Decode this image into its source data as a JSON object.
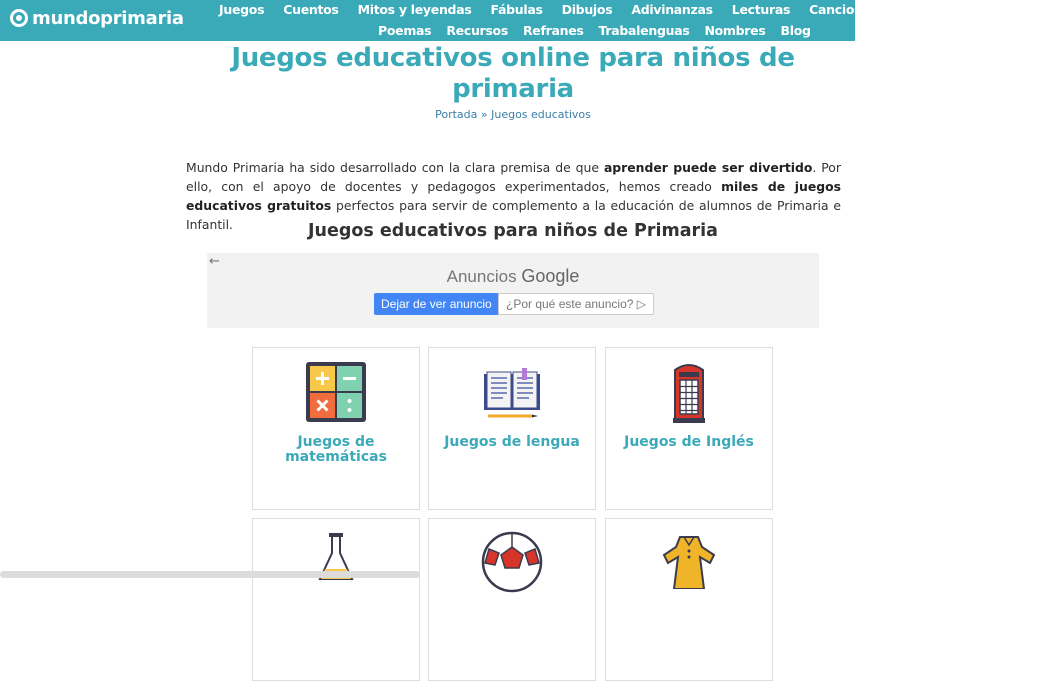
{
  "site": {
    "name": "mundoprimaria"
  },
  "nav": {
    "row1": [
      "Juegos",
      "Cuentos",
      "Mitos y leyendas",
      "Fábulas",
      "Dibujos",
      "Adivinanzas",
      "Lecturas",
      "Canciones"
    ],
    "row2": [
      "Poemas",
      "Recursos",
      "Refranes",
      "Trabalenguas",
      "Nombres",
      "Blog"
    ]
  },
  "page": {
    "title": "Juegos educativos online para niños de primaria",
    "breadcrumb": {
      "home": "Portada",
      "sep": " » ",
      "current": "Juegos educativos"
    },
    "intro": {
      "p1": "Mundo Primaria ha sido desarrollado con la clara premisa de que ",
      "b1": "aprender puede ser divertido",
      "p2": ". Por ello, con el apoyo de docentes y pedagogos experimentados, hemos creado ",
      "b2": "miles de juegos educativos gratuitos",
      "p3": " perfectos para servir de complemento a la educación de alumnos de Primaria e Infantil."
    },
    "section_title": "Juegos educativos para niños de Primaria"
  },
  "ad": {
    "back": "←",
    "label": "Anuncios",
    "brand": "Google",
    "stop": "Dejar de ver anuncio",
    "why": "¿Por qué este anuncio? ▷"
  },
  "cards": [
    {
      "label": "Juegos de matemáticas",
      "icon": "calculator-icon"
    },
    {
      "label": "Juegos de lengua",
      "icon": "open-book-icon"
    },
    {
      "label": "Juegos de Inglés",
      "icon": "phone-booth-icon"
    },
    {
      "label": "",
      "icon": "flask-icon"
    },
    {
      "label": "",
      "icon": "soccer-ball-icon"
    },
    {
      "label": "",
      "icon": "dress-icon"
    }
  ],
  "colors": {
    "brand": "#3aa9b8",
    "link": "#3a7fa8",
    "ad_button": "#4285f4"
  }
}
